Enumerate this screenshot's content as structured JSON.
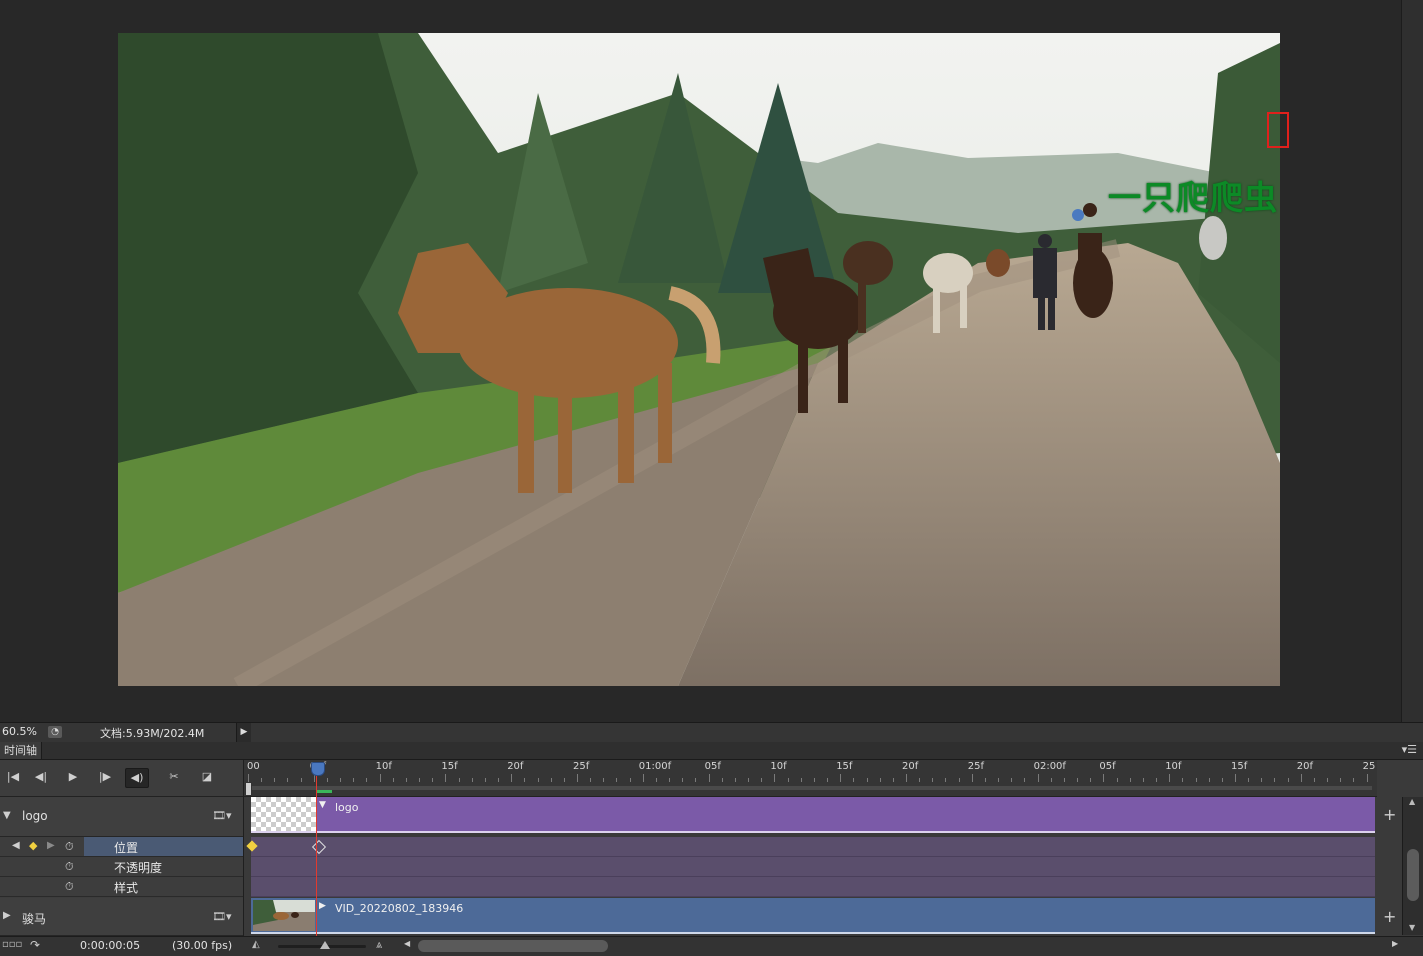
{
  "canvas": {
    "overlay_text": "一只爬爬虫"
  },
  "status_bar": {
    "zoom": "60.5%",
    "doc_info": "文档:5.93M/202.4M"
  },
  "timeline": {
    "panel_title": "时间轴",
    "ruler_labels": [
      "00",
      "05f",
      "10f",
      "15f",
      "20f",
      "25f",
      "01:00f",
      "05f",
      "10f",
      "15f",
      "20f",
      "25f",
      "02:00f",
      "05f",
      "10f",
      "15f",
      "20f",
      "25"
    ],
    "layers": [
      {
        "name": "logo",
        "clip_label": "logo",
        "properties": [
          "位置",
          "不透明度",
          "样式"
        ]
      },
      {
        "name": "骏马",
        "clip_label": "VID_20220802_183946"
      }
    ],
    "timecode": "0:00:00:05",
    "fps": "(30.00 fps)"
  },
  "colors": {
    "logo_track": "#7b5aa8",
    "video_track": "#4d6a98",
    "playhead": "#e23a2e",
    "selection_box": "#e0201c",
    "overlay_text": "#0c8a26"
  }
}
